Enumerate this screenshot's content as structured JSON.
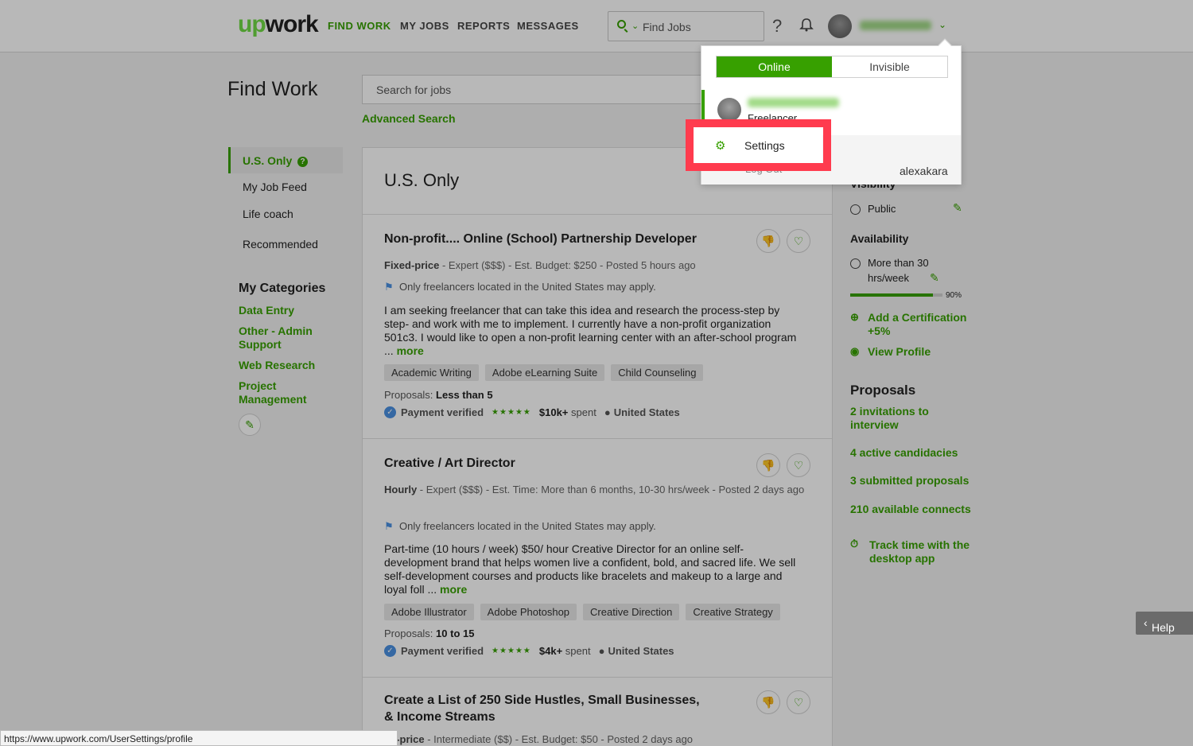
{
  "header": {
    "logo_up": "up",
    "logo_rest": "work",
    "nav": [
      "FIND WORK",
      "MY JOBS",
      "REPORTS",
      "MESSAGES"
    ],
    "search_placeholder": "Find Jobs",
    "help_glyph": "?",
    "icons": [
      "search-icon",
      "chevron-down-icon",
      "help-icon",
      "bell-icon",
      "avatar"
    ]
  },
  "sidebar": {
    "title": "Find Work",
    "items": [
      "U.S. Only",
      "My Job Feed",
      "Life coach",
      "Recommended"
    ],
    "categories_head": "My Categories",
    "categories": [
      "Data Entry",
      "Other - Admin Support",
      "Web Research",
      "Project Management"
    ]
  },
  "search": {
    "placeholder": "Search for jobs",
    "advanced": "Advanced Search"
  },
  "feed": {
    "title": "U.S. Only",
    "jobs": [
      {
        "title": "Non-profit.... Online (School) Partnership Developer",
        "type": "Fixed-price",
        "meta": " - Expert ($$$) - Est. Budget: $250 - Posted 5 hours ago",
        "location_note": "Only freelancers located in the United States may apply.",
        "description": "I am seeking freelancer that can take this idea and research the process-step by step- and work with me to implement. I currently have a non-profit organization 501c3. I would like to open a non-profit learning center with an after-school program ...",
        "more": "more",
        "tags": [
          "Academic Writing",
          "Adobe eLearning Suite",
          "Child Counseling"
        ],
        "proposals_label": "Proposals:",
        "proposals_value": "Less than 5",
        "payment": "Payment verified",
        "stars": "★★★★★",
        "spent_value": "$10k+",
        "spent_label": "spent",
        "country": "United States"
      },
      {
        "title": "Creative / Art Director",
        "type": "Hourly",
        "meta": " - Expert ($$$) - Est. Time: More than 6 months, 10-30 hrs/week - Posted 2 days ago",
        "location_note": "Only freelancers located in the United States may apply.",
        "description": "Part-time (10 hours / week) $50/ hour Creative Director for an online self-development brand that helps women live a confident, bold, and sacred life. We sell self-development courses and products like bracelets and makeup to a large and loyal foll ...",
        "more": "more",
        "tags": [
          "Adobe Illustrator",
          "Adobe Photoshop",
          "Creative Direction",
          "Creative Strategy"
        ],
        "proposals_label": "Proposals:",
        "proposals_value": "10 to 15",
        "payment": "Payment verified",
        "stars": "★★★★★",
        "spent_value": "$4k+",
        "spent_label": "spent",
        "country": "United States"
      },
      {
        "title": "Create a List of 250 Side Hustles, Small Businesses, & Income Streams",
        "type": "ed-price",
        "meta": " - Intermediate ($$) - Est. Budget: $50 - Posted 2 days ago"
      }
    ]
  },
  "right": {
    "visibility_label": "Visibility",
    "visibility_value": "Public",
    "availability_label": "Availability",
    "availability_value": "More than 30 hrs/week",
    "profile_completeness": 0.9,
    "profile_completeness_label": "90%",
    "add_cert": "Add a Certification +5%",
    "view_profile": "View Profile",
    "proposals_head": "Proposals",
    "proposal_links": [
      "2 invitations to interview",
      "4 active candidacies",
      "3 submitted proposals",
      "210 available connects"
    ],
    "track_time": "Track time with the desktop app"
  },
  "dropdown": {
    "online": "Online",
    "invisible": "Invisible",
    "role": "Freelancer",
    "settings": "Settings",
    "logout": "Log Out",
    "username": "alexakara"
  },
  "help_button": "Help",
  "status_url": "https://www.upwork.com/UserSettings/profile",
  "colors": {
    "brand_green": "#37a000",
    "highlight_red": "#ff3b4e"
  }
}
